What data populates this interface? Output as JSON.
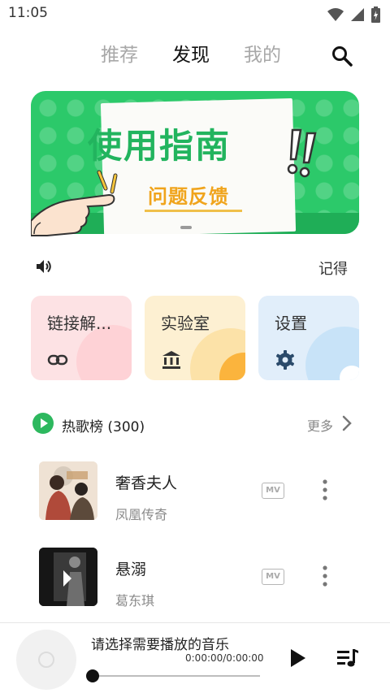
{
  "status_bar": {
    "time": "11:05",
    "icons": [
      "wifi-icon",
      "signal-icon",
      "battery-charging-icon"
    ]
  },
  "tabs": [
    {
      "label": "推荐",
      "active": false
    },
    {
      "label": "发现",
      "active": true
    },
    {
      "label": "我的",
      "active": false
    }
  ],
  "banner": {
    "title": "使用指南",
    "subtitle": "问题反馈",
    "background_color": "#2cc96a",
    "accent_color": "#f0a41c"
  },
  "notice": {
    "text": "记得"
  },
  "cards": [
    {
      "label": "链接解...",
      "icon": "link-icon",
      "background_color": "#fde2e4"
    },
    {
      "label": "实验室",
      "icon": "bank-icon",
      "background_color": "#fdf0d2"
    },
    {
      "label": "设置",
      "icon": "gear-icon",
      "background_color": "#e1eefa"
    }
  ],
  "hot_songs": {
    "title": "热歌榜 (300)",
    "more_label": "更多",
    "accent_color": "#2db85e",
    "songs": [
      {
        "title": "奢香夫人",
        "artist": "凤凰传奇",
        "mv_label": "MV"
      },
      {
        "title": "悬溺",
        "artist": "葛东琪",
        "mv_label": "MV"
      }
    ]
  },
  "player": {
    "title": "请选择需要播放的音乐",
    "time": "0:00:00/0:00:00",
    "progress": 0
  }
}
